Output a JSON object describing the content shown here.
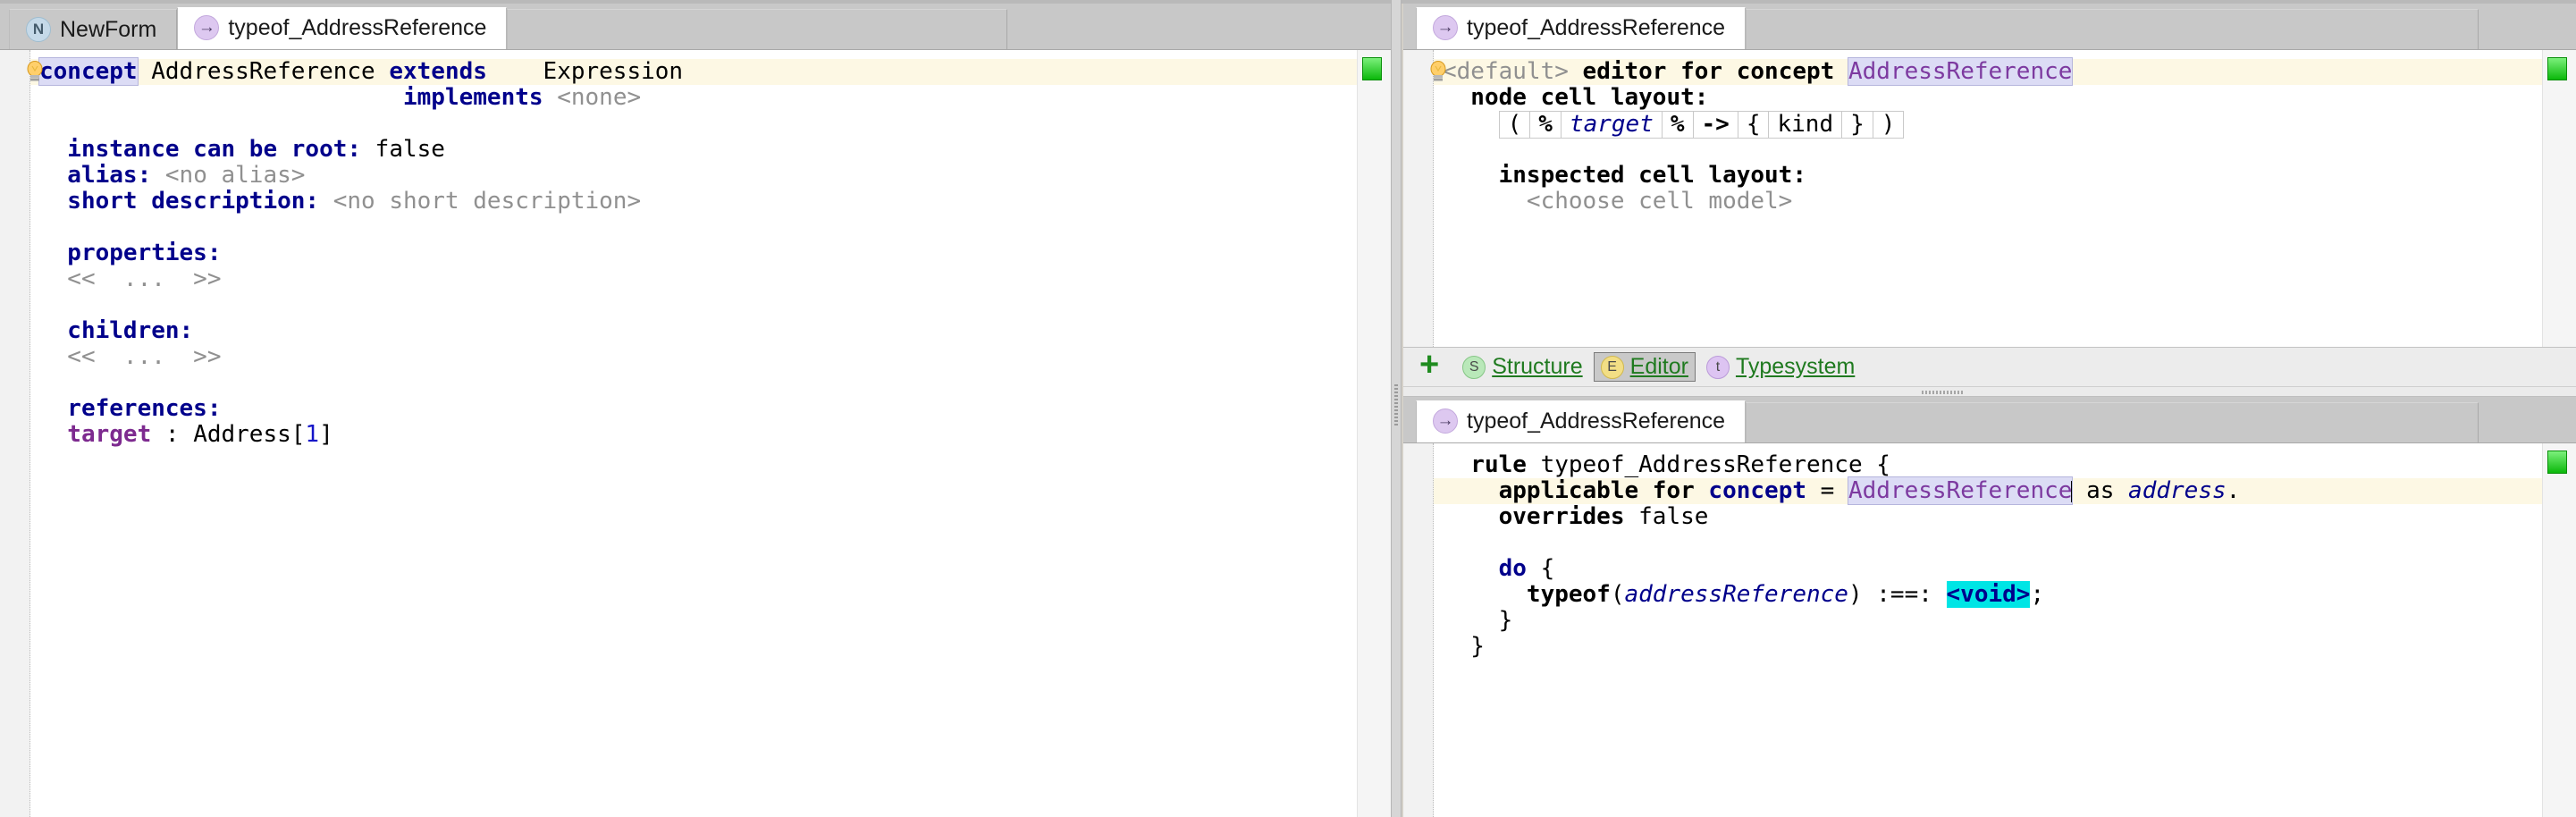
{
  "left_pane": {
    "tabs": [
      {
        "label": "NewForm",
        "icon": "node-n-icon",
        "icon_glyph": "N",
        "active": false
      },
      {
        "label": "typeof_AddressReference",
        "icon": "node-arrow-icon",
        "icon_glyph": "→",
        "active": true
      }
    ],
    "error_marker_color": "#0bb80b",
    "lines": [
      {
        "indent": 0,
        "bulb": true,
        "highlight": true,
        "tokens": [
          {
            "t": "concept",
            "c": "kw selbox"
          },
          {
            "t": " AddressReference ",
            "c": "plain"
          },
          {
            "t": "extends",
            "c": "kw"
          },
          {
            "t": "    Expression",
            "c": "plain"
          }
        ]
      },
      {
        "indent": 0,
        "tokens": [
          {
            "t": "                          ",
            "c": "plain"
          },
          {
            "t": "implements",
            "c": "kw"
          },
          {
            "t": " ",
            "c": "plain"
          },
          {
            "t": "<none>",
            "c": "gray"
          }
        ]
      },
      {
        "indent": 0,
        "tokens": []
      },
      {
        "indent": 0,
        "tokens": [
          {
            "t": "  instance can be root:",
            "c": "kw"
          },
          {
            "t": " false",
            "c": "plain"
          }
        ]
      },
      {
        "indent": 0,
        "tokens": [
          {
            "t": "  alias:",
            "c": "kw"
          },
          {
            "t": " ",
            "c": "plain"
          },
          {
            "t": "<no alias>",
            "c": "gray"
          }
        ]
      },
      {
        "indent": 0,
        "tokens": [
          {
            "t": "  short description:",
            "c": "kw"
          },
          {
            "t": " ",
            "c": "plain"
          },
          {
            "t": "<no short description>",
            "c": "gray"
          }
        ]
      },
      {
        "indent": 0,
        "tokens": []
      },
      {
        "indent": 0,
        "tokens": [
          {
            "t": "  properties:",
            "c": "kw"
          }
        ]
      },
      {
        "indent": 0,
        "tokens": [
          {
            "t": "  <<  ...  >>",
            "c": "gray"
          }
        ]
      },
      {
        "indent": 0,
        "tokens": []
      },
      {
        "indent": 0,
        "tokens": [
          {
            "t": "  children:",
            "c": "kw"
          }
        ]
      },
      {
        "indent": 0,
        "tokens": [
          {
            "t": "  <<  ...  >>",
            "c": "gray"
          }
        ]
      },
      {
        "indent": 0,
        "tokens": []
      },
      {
        "indent": 0,
        "tokens": [
          {
            "t": "  references:",
            "c": "kw"
          }
        ]
      },
      {
        "indent": 0,
        "tokens": [
          {
            "t": "  target",
            "c": "purple"
          },
          {
            "t": " : Address[",
            "c": "plain"
          },
          {
            "t": "1",
            "c": "num"
          },
          {
            "t": "]",
            "c": "plain"
          }
        ]
      }
    ]
  },
  "top_right_pane": {
    "tabs": [
      {
        "label": "typeof_AddressReference",
        "icon": "node-arrow-icon",
        "icon_glyph": "→",
        "active": true
      }
    ],
    "error_marker_color": "#0bb80b",
    "lines": [
      {
        "bulb": true,
        "highlight": true,
        "tokens": [
          {
            "t": "<default>",
            "c": "gray"
          },
          {
            "t": " editor for concept ",
            "c": "kwb"
          },
          {
            "t": "AddressReference",
            "c": "purplep selbox"
          }
        ]
      },
      {
        "tokens": [
          {
            "t": "  node cell layout:",
            "c": "kwb"
          }
        ]
      },
      {
        "cells": [
          "(",
          "%",
          "target",
          "%",
          "->",
          "{",
          "kind",
          "}",
          ")"
        ],
        "cell_styles": [
          "plain",
          "kwb",
          "ital",
          "kwb",
          "kwb",
          "plain",
          "plain",
          "plain",
          "plain"
        ],
        "indent": 4
      },
      {
        "tokens": []
      },
      {
        "tokens": [
          {
            "t": "    inspected cell layout:",
            "c": "kwb"
          }
        ]
      },
      {
        "tokens": [
          {
            "t": "      <choose cell model>",
            "c": "gray"
          }
        ]
      }
    ],
    "aspect_bar": {
      "add_label": "+",
      "tabs": [
        {
          "label": "Structure",
          "glyph": "S",
          "kind": "s",
          "selected": false
        },
        {
          "label": "Editor",
          "glyph": "E",
          "kind": "e",
          "selected": true
        },
        {
          "label": "Typesystem",
          "glyph": "t",
          "kind": "t",
          "selected": false
        }
      ]
    }
  },
  "bottom_right_pane": {
    "tabs": [
      {
        "label": "typeof_AddressReference",
        "icon": "node-arrow-icon",
        "icon_glyph": "→",
        "active": true
      }
    ],
    "error_marker_color": "#0bb80b",
    "lines": [
      {
        "tokens": [
          {
            "t": "  rule",
            "c": "kwb"
          },
          {
            "t": " typeof_AddressReference {",
            "c": "plain"
          }
        ]
      },
      {
        "highlight": true,
        "tokens": [
          {
            "t": "    applicable for ",
            "c": "kwb"
          },
          {
            "t": "concept",
            "c": "kw"
          },
          {
            "t": " = ",
            "c": "plain"
          },
          {
            "t": "AddressReference",
            "c": "purplep selbox"
          },
          {
            "t": "CARET",
            "c": "caret"
          },
          {
            "t": " as ",
            "c": "plain"
          },
          {
            "t": "address",
            "c": "ital"
          },
          {
            "t": ".",
            "c": "plain"
          }
        ]
      },
      {
        "tokens": [
          {
            "t": "    overrides",
            "c": "kwb"
          },
          {
            "t": " false",
            "c": "plain"
          }
        ]
      },
      {
        "tokens": []
      },
      {
        "tokens": [
          {
            "t": "    do",
            "c": "kw"
          },
          {
            "t": " {",
            "c": "plain"
          }
        ]
      },
      {
        "tokens": [
          {
            "t": "      typeof",
            "c": "kwb"
          },
          {
            "t": "(",
            "c": "plain"
          },
          {
            "t": "addressReference",
            "c": "ital"
          },
          {
            "t": ") :==: ",
            "c": "plain"
          },
          {
            "t": "<void>",
            "c": "voidsel"
          },
          {
            "t": ";",
            "c": "plain"
          }
        ]
      },
      {
        "tokens": [
          {
            "t": "    }",
            "c": "plain"
          }
        ]
      },
      {
        "tokens": [
          {
            "t": "  }",
            "c": "plain"
          }
        ]
      }
    ]
  }
}
